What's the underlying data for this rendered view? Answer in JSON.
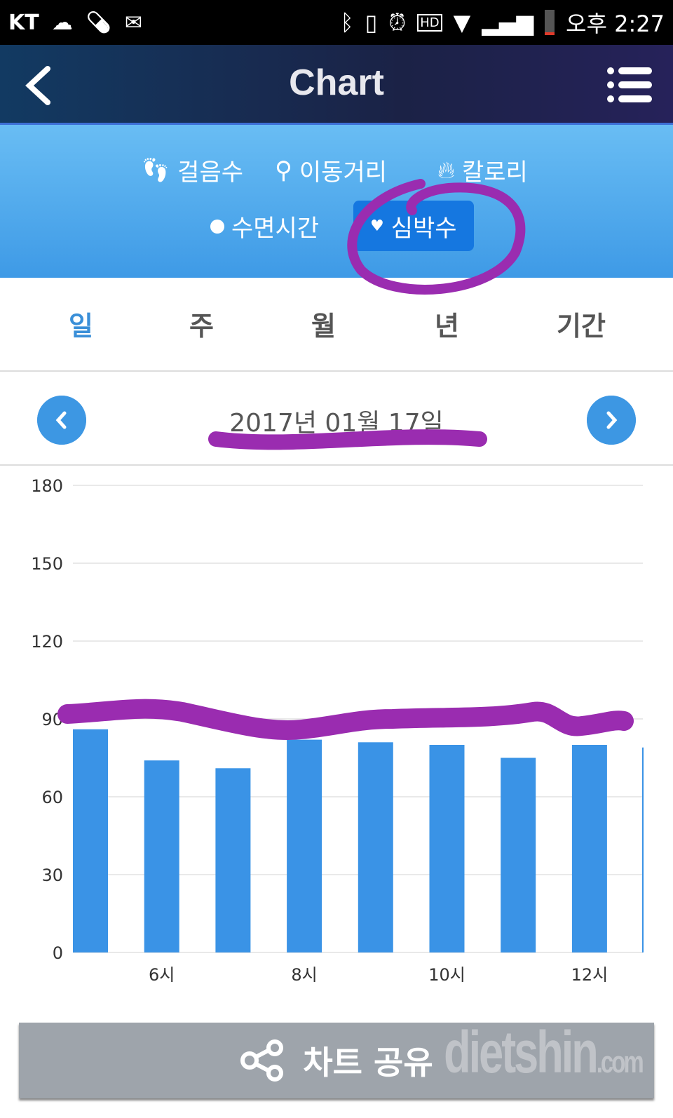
{
  "status_bar": {
    "carrier": "KT",
    "time": "오후 2:27"
  },
  "header": {
    "title": "Chart"
  },
  "metrics": [
    {
      "label": "걸음수",
      "icon": "footprints-icon"
    },
    {
      "label": "이동거리",
      "icon": "location-pin-icon"
    },
    {
      "label": "칼로리",
      "icon": "flame-icon"
    },
    {
      "label": "수면시간",
      "icon": "moon-icon"
    },
    {
      "label": "심박수",
      "icon": "heartbeat-icon",
      "selected": true
    }
  ],
  "periods": [
    {
      "label": "일",
      "selected": true
    },
    {
      "label": "주"
    },
    {
      "label": "월"
    },
    {
      "label": "년"
    },
    {
      "label": "기간"
    }
  ],
  "date": "2017년 01월 17일",
  "share": {
    "label": "차트 공유"
  },
  "watermark": "dietshin.com",
  "colors": {
    "bar": "#3a93e6",
    "accent": "#3a8fd8",
    "selected_metric": "#1577e0",
    "annotation": "#9a2cb0"
  },
  "chart_data": {
    "type": "bar",
    "x": [
      5,
      6,
      7,
      8,
      9,
      10,
      11,
      12,
      13
    ],
    "values": [
      86,
      74,
      71,
      82,
      81,
      80,
      75,
      80,
      79
    ],
    "x_tick_labels": [
      {
        "x": 6,
        "label": "6시"
      },
      {
        "x": 8,
        "label": "8시"
      },
      {
        "x": 10,
        "label": "10시"
      },
      {
        "x": 12,
        "label": "12시"
      }
    ],
    "y_ticks": [
      0,
      30,
      60,
      90,
      120,
      150,
      180
    ],
    "ylim": [
      0,
      180
    ],
    "grid": true
  }
}
